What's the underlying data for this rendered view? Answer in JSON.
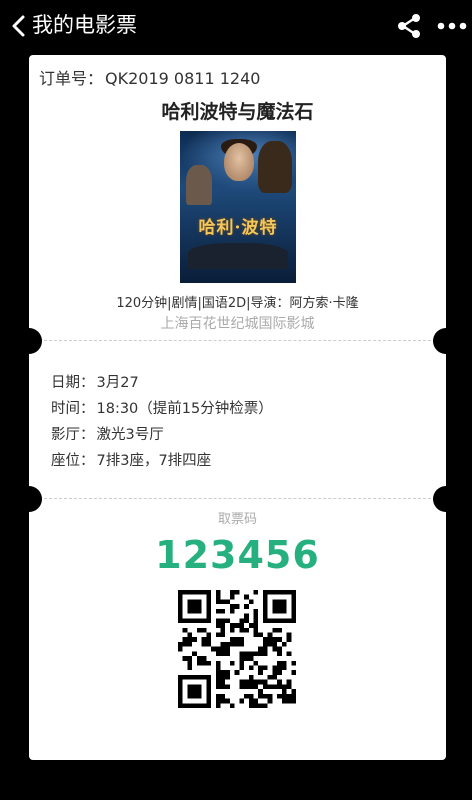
{
  "header": {
    "title": "我的电影票"
  },
  "ticket": {
    "order_label": "订单号：",
    "order_number": "QK2019 0811 1240",
    "movie_title": "哈利波特与魔法石",
    "poster_title": "哈利·波特",
    "info_line": "120分钟|剧情|国语2D|导演：阿方索·卡隆",
    "cinema": "上海百花世纪城国际影城",
    "details": {
      "date_label": "日期：",
      "date": "3月27",
      "time_label": "时间：",
      "time": "18:30（提前15分钟检票）",
      "hall_label": "影厅：",
      "hall": "激光3号厅",
      "seat_label": "座位：",
      "seat": "7排3座，7排四座"
    },
    "code_label": "取票码",
    "code": "123456"
  },
  "colors": {
    "background": "#000000",
    "card": "#ffffff",
    "code_green": "#26b07f",
    "muted": "#aaaaaa"
  },
  "icons": {
    "back": "chevron-left-icon",
    "share": "share-icon",
    "more": "more-dots-icon",
    "qr": "qr-code-icon"
  }
}
